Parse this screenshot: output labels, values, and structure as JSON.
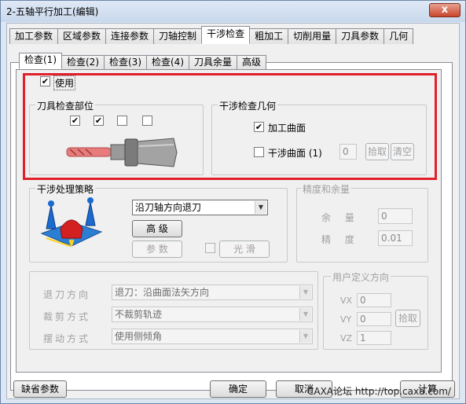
{
  "window": {
    "title": "2-五轴平行加工(编辑)",
    "close_symbol": "x"
  },
  "main_tabs": [
    {
      "label": "加工参数",
      "active": false
    },
    {
      "label": "区域参数",
      "active": false
    },
    {
      "label": "连接参数",
      "active": false
    },
    {
      "label": "刀轴控制",
      "active": false
    },
    {
      "label": "干涉检查",
      "active": true
    },
    {
      "label": "粗加工",
      "active": false
    },
    {
      "label": "切削用量",
      "active": false
    },
    {
      "label": "刀具参数",
      "active": false
    },
    {
      "label": "几何",
      "active": false
    }
  ],
  "sub_tabs": [
    {
      "label": "检查(1)",
      "active": true
    },
    {
      "label": "检查(2)",
      "active": false
    },
    {
      "label": "检查(3)",
      "active": false
    },
    {
      "label": "检查(4)",
      "active": false
    },
    {
      "label": "刀具余量",
      "active": false
    },
    {
      "label": "高级",
      "active": false
    }
  ],
  "use": {
    "label": "使用",
    "checked": true
  },
  "tool_parts": {
    "title": "刀具检查部位",
    "checks": [
      true,
      true,
      false,
      false
    ]
  },
  "geometry": {
    "title": "干涉检查几何",
    "machined_surface": {
      "label": "加工曲面",
      "checked": true
    },
    "interference_surface": {
      "label": "干涉曲面 (1)",
      "checked": false,
      "count": "0"
    },
    "pick_button": "拾取",
    "clear_button": "清空"
  },
  "strategy": {
    "title": "干涉处理策略",
    "method": "沿刀轴方向退刀",
    "advanced_button": "高 级",
    "params_button": "参 数",
    "smooth_label": "光 滑",
    "smooth_checked": false
  },
  "precision": {
    "title": "精度和余量",
    "margin_label": "余 量",
    "margin_value": "0",
    "precision_label": "精 度",
    "precision_value": "0.01"
  },
  "retract": {
    "direction_label": "退刀方向",
    "direction_value": "退刀：沿曲面法矢方向",
    "trim_label": "裁剪方式",
    "trim_value": "不裁剪轨迹",
    "swing_label": "摆动方式",
    "swing_value": "使用侧倾角"
  },
  "user_dir": {
    "title": "用户定义方向",
    "vx_label": "VX",
    "vx_value": "0",
    "vy_label": "VY",
    "vy_value": "0",
    "vz_label": "VZ",
    "vz_value": "1",
    "pick_button": "拾取"
  },
  "footer": {
    "default_button": "缺省参数",
    "ok_button": "确定",
    "cancel_button": "取消",
    "watermark": "CAXA论坛 http://top.caxa.com/",
    "calc_button": "计算"
  },
  "colors": {
    "highlight_box": "#e0202a",
    "tool_pink": "#e87c7c",
    "holder_gray": "#8a8a8a"
  }
}
